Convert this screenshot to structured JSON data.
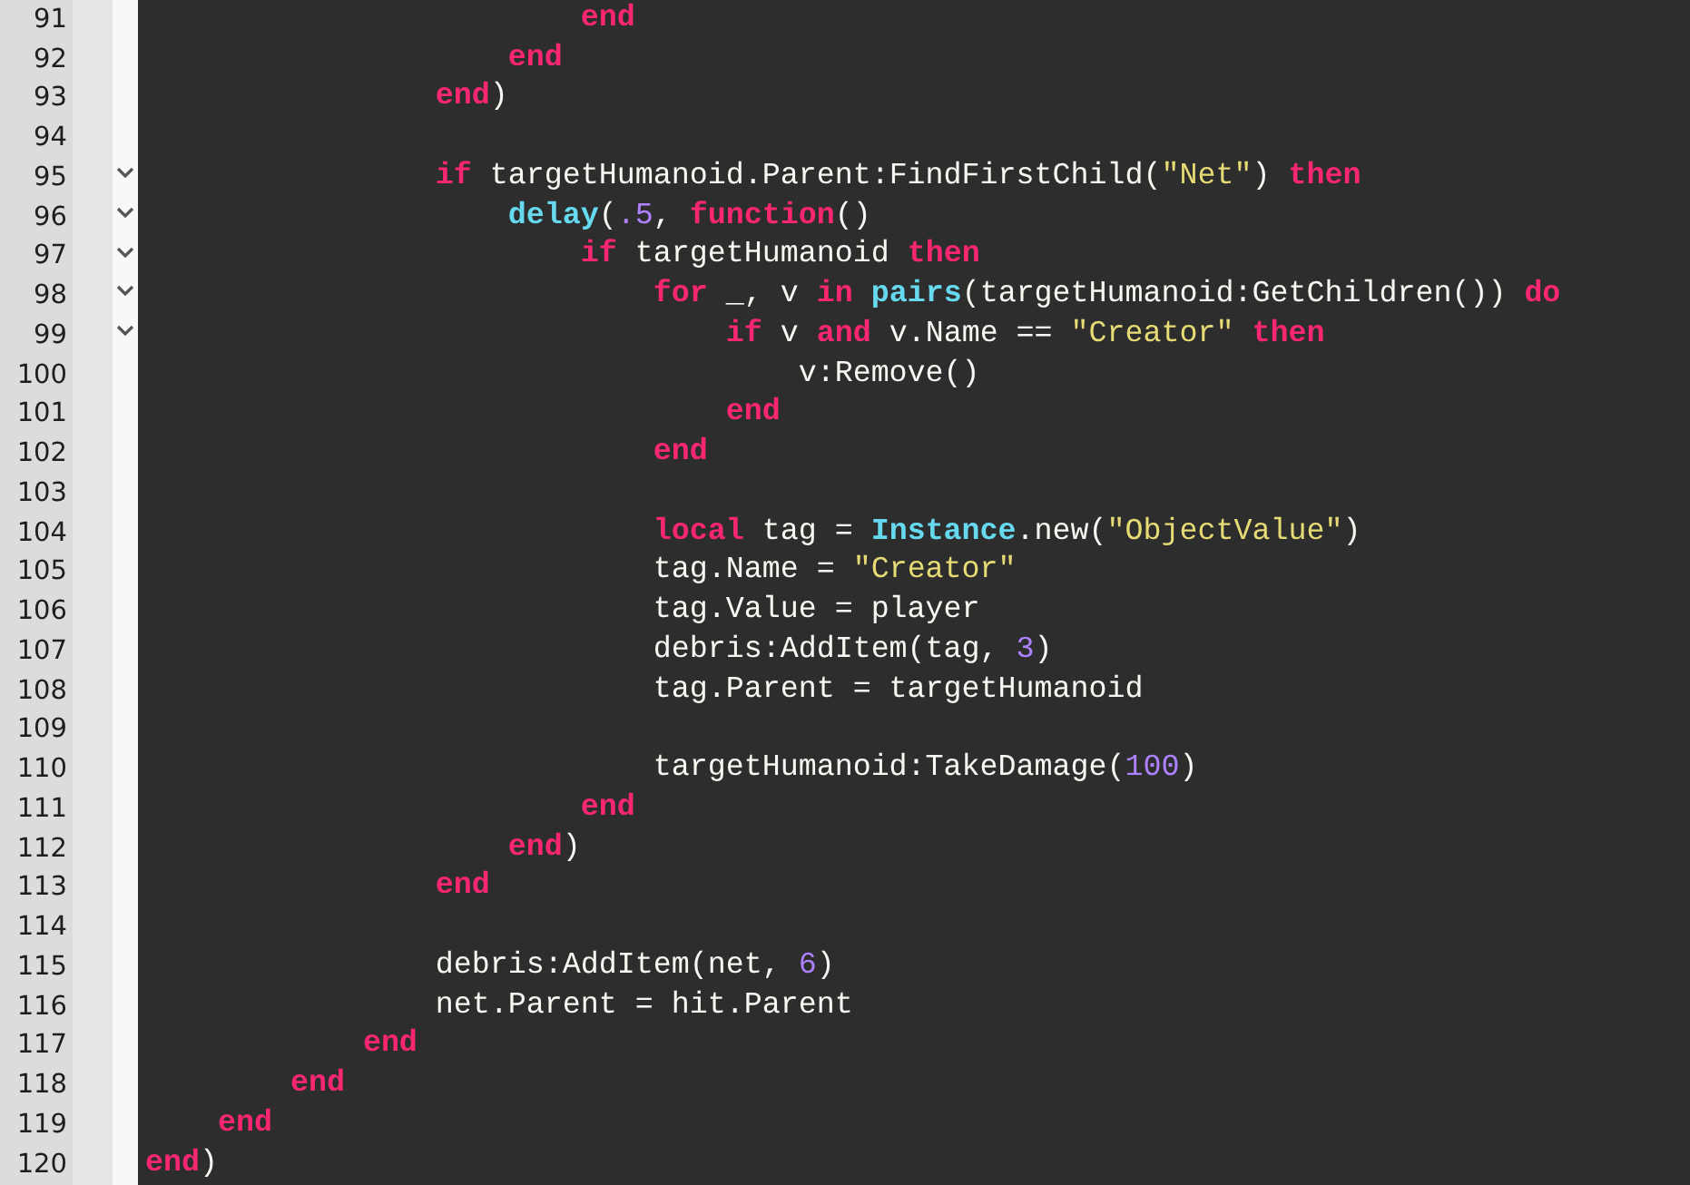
{
  "editor": {
    "lines": [
      {
        "number": "91",
        "foldable": false,
        "tokens": [
          {
            "kind": "keyword",
            "text": "                        end"
          }
        ]
      },
      {
        "number": "92",
        "foldable": false,
        "tokens": [
          {
            "kind": "keyword",
            "text": "                    end"
          }
        ]
      },
      {
        "number": "93",
        "foldable": false,
        "tokens": [
          {
            "kind": "keyword",
            "text": "                end"
          },
          {
            "kind": "plain",
            "text": ")"
          }
        ]
      },
      {
        "number": "94",
        "foldable": false
      },
      {
        "number": "95",
        "foldable": true,
        "tokens": [
          {
            "kind": "keyword",
            "text": "                if"
          },
          {
            "kind": "plain",
            "text": " targetHumanoid.Parent:FindFirstChild("
          },
          {
            "kind": "string",
            "text": "\"Net\""
          },
          {
            "kind": "plain",
            "text": ") "
          },
          {
            "kind": "keyword",
            "text": "then"
          }
        ]
      },
      {
        "number": "96",
        "foldable": true,
        "tokens": [
          {
            "kind": "builtin",
            "text": "                    delay"
          },
          {
            "kind": "plain",
            "text": "("
          },
          {
            "kind": "number",
            "text": ".5"
          },
          {
            "kind": "plain",
            "text": ", "
          },
          {
            "kind": "keyword",
            "text": "function"
          },
          {
            "kind": "plain",
            "text": "()"
          }
        ]
      },
      {
        "number": "97",
        "foldable": true,
        "tokens": [
          {
            "kind": "keyword",
            "text": "                        if"
          },
          {
            "kind": "plain",
            "text": " targetHumanoid "
          },
          {
            "kind": "keyword",
            "text": "then"
          }
        ]
      },
      {
        "number": "98",
        "foldable": true,
        "tokens": [
          {
            "kind": "keyword",
            "text": "                            for"
          },
          {
            "kind": "plain",
            "text": " _, v "
          },
          {
            "kind": "keyword",
            "text": "in"
          },
          {
            "kind": "builtin",
            "text": " pairs"
          },
          {
            "kind": "plain",
            "text": "(targetHumanoid:GetChildren()) "
          },
          {
            "kind": "keyword",
            "text": "do"
          }
        ]
      },
      {
        "number": "99",
        "foldable": true,
        "tokens": [
          {
            "kind": "keyword",
            "text": "                                if"
          },
          {
            "kind": "plain",
            "text": " v "
          },
          {
            "kind": "keyword",
            "text": "and"
          },
          {
            "kind": "plain",
            "text": " v.Name == "
          },
          {
            "kind": "string",
            "text": "\"Creator\""
          },
          {
            "kind": "keyword",
            "text": " then"
          }
        ]
      },
      {
        "number": "100",
        "foldable": false,
        "tokens": [
          {
            "kind": "plain",
            "text": "                                    v:Remove()"
          }
        ]
      },
      {
        "number": "101",
        "foldable": false,
        "tokens": [
          {
            "kind": "keyword",
            "text": "                                end"
          }
        ]
      },
      {
        "number": "102",
        "foldable": false,
        "tokens": [
          {
            "kind": "keyword",
            "text": "                            end"
          }
        ]
      },
      {
        "number": "103",
        "foldable": false
      },
      {
        "number": "104",
        "foldable": false,
        "tokens": [
          {
            "kind": "keyword",
            "text": "                            local"
          },
          {
            "kind": "plain",
            "text": " tag = "
          },
          {
            "kind": "builtin",
            "text": "Instance"
          },
          {
            "kind": "plain",
            "text": ".new("
          },
          {
            "kind": "string",
            "text": "\"ObjectValue\""
          },
          {
            "kind": "plain",
            "text": ")"
          }
        ]
      },
      {
        "number": "105",
        "foldable": false,
        "tokens": [
          {
            "kind": "plain",
            "text": "                            tag.Name = "
          },
          {
            "kind": "string",
            "text": "\"Creator\""
          }
        ]
      },
      {
        "number": "106",
        "foldable": false,
        "tokens": [
          {
            "kind": "plain",
            "text": "                            tag.Value = player"
          }
        ]
      },
      {
        "number": "107",
        "foldable": false,
        "tokens": [
          {
            "kind": "plain",
            "text": "                            debris:AddItem(tag, "
          },
          {
            "kind": "number",
            "text": "3"
          },
          {
            "kind": "plain",
            "text": ")"
          }
        ]
      },
      {
        "number": "108",
        "foldable": false,
        "tokens": [
          {
            "kind": "plain",
            "text": "                            tag.Parent = targetHumanoid"
          }
        ]
      },
      {
        "number": "109",
        "foldable": false
      },
      {
        "number": "110",
        "foldable": false,
        "tokens": [
          {
            "kind": "plain",
            "text": "                            targetHumanoid:TakeDamage("
          },
          {
            "kind": "number",
            "text": "100"
          },
          {
            "kind": "plain",
            "text": ")"
          }
        ]
      },
      {
        "number": "111",
        "foldable": false,
        "tokens": [
          {
            "kind": "keyword",
            "text": "                        end"
          }
        ]
      },
      {
        "number": "112",
        "foldable": false,
        "tokens": [
          {
            "kind": "keyword",
            "text": "                    end"
          },
          {
            "kind": "plain",
            "text": ")"
          }
        ]
      },
      {
        "number": "113",
        "foldable": false,
        "tokens": [
          {
            "kind": "keyword",
            "text": "                end"
          }
        ]
      },
      {
        "number": "114",
        "foldable": false
      },
      {
        "number": "115",
        "foldable": false,
        "tokens": [
          {
            "kind": "plain",
            "text": "                debris:AddItem(net, "
          },
          {
            "kind": "number",
            "text": "6"
          },
          {
            "kind": "plain",
            "text": ")"
          }
        ]
      },
      {
        "number": "116",
        "foldable": false,
        "tokens": [
          {
            "kind": "plain",
            "text": "                net.Parent = hit.Parent"
          }
        ]
      },
      {
        "number": "117",
        "foldable": false,
        "tokens": [
          {
            "kind": "keyword",
            "text": "            end"
          }
        ]
      },
      {
        "number": "118",
        "foldable": false,
        "tokens": [
          {
            "kind": "keyword",
            "text": "        end"
          }
        ]
      },
      {
        "number": "119",
        "foldable": false,
        "tokens": [
          {
            "kind": "keyword",
            "text": "    end"
          }
        ]
      },
      {
        "number": "120",
        "foldable": false,
        "tokens": [
          {
            "kind": "keyword",
            "text": "end"
          },
          {
            "kind": "plain",
            "text": ")"
          }
        ]
      }
    ]
  }
}
